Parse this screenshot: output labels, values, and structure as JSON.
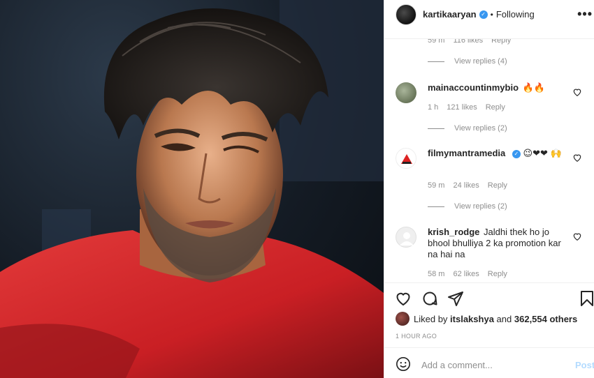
{
  "header": {
    "username": "kartikaaryan",
    "dot": "•",
    "following": "Following",
    "more": "•••"
  },
  "comments": {
    "partial": {
      "time": "59 m",
      "likes": "116 likes",
      "reply": "Reply"
    },
    "replies_1": "View replies (4)",
    "items": [
      {
        "user": "mainaccountinmybio",
        "text": "🔥🔥",
        "time": "1 h",
        "likes": "121 likes",
        "reply": "Reply",
        "view_replies": "View replies (2)"
      },
      {
        "user": "filmymantramedia",
        "text": "😉❤❤ 🙌",
        "time": "59 m",
        "likes": "24 likes",
        "reply": "Reply",
        "view_replies": "View replies (2)"
      },
      {
        "user": "krish_rodge",
        "text": "Jaldhi thek ho jo bhool bhulliya 2 ka promotion kar na hai na",
        "time": "58 m",
        "likes": "62 likes",
        "reply": "Reply"
      }
    ]
  },
  "likes": {
    "prefix": "Liked by",
    "user": "itslakshya",
    "and": "and",
    "count": "362,554 others"
  },
  "time_ago": "1 HOUR AGO",
  "comment_bar": {
    "placeholder": "Add a comment...",
    "post": "Post"
  },
  "icons": [
    "heart-icon",
    "comment-icon",
    "share-icon",
    "bookmark-icon",
    "emoji-icon",
    "verified-icon"
  ],
  "colors": {
    "verified": "#3897f0",
    "muted": "#8e8e8e",
    "post_disabled": "#b3dbff",
    "shirt": "#d42a2a"
  }
}
